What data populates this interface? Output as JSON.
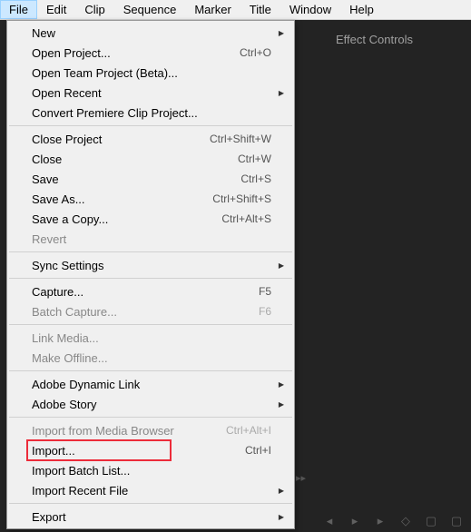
{
  "menubar": {
    "items": [
      "File",
      "Edit",
      "Clip",
      "Sequence",
      "Marker",
      "Title",
      "Window",
      "Help"
    ],
    "active_index": 0
  },
  "panel": {
    "tab_label": "Effect Controls"
  },
  "file_menu": {
    "groups": [
      [
        {
          "label": "New",
          "shortcut": "",
          "submenu": true
        },
        {
          "label": "Open Project...",
          "shortcut": "Ctrl+O"
        },
        {
          "label": "Open Team Project (Beta)...",
          "shortcut": ""
        },
        {
          "label": "Open Recent",
          "shortcut": "",
          "submenu": true
        },
        {
          "label": "Convert Premiere Clip Project...",
          "shortcut": ""
        }
      ],
      [
        {
          "label": "Close Project",
          "shortcut": "Ctrl+Shift+W"
        },
        {
          "label": "Close",
          "shortcut": "Ctrl+W"
        },
        {
          "label": "Save",
          "shortcut": "Ctrl+S"
        },
        {
          "label": "Save As...",
          "shortcut": "Ctrl+Shift+S"
        },
        {
          "label": "Save a Copy...",
          "shortcut": "Ctrl+Alt+S"
        },
        {
          "label": "Revert",
          "shortcut": "",
          "disabled": true
        }
      ],
      [
        {
          "label": "Sync Settings",
          "shortcut": "",
          "submenu": true
        }
      ],
      [
        {
          "label": "Capture...",
          "shortcut": "F5"
        },
        {
          "label": "Batch Capture...",
          "shortcut": "F6",
          "disabled": true
        }
      ],
      [
        {
          "label": "Link Media...",
          "shortcut": "",
          "disabled": true
        },
        {
          "label": "Make Offline...",
          "shortcut": "",
          "disabled": true
        }
      ],
      [
        {
          "label": "Adobe Dynamic Link",
          "shortcut": "",
          "submenu": true
        },
        {
          "label": "Adobe Story",
          "shortcut": "",
          "submenu": true
        }
      ],
      [
        {
          "label": "Import from Media Browser",
          "shortcut": "Ctrl+Alt+I",
          "disabled": true
        },
        {
          "label": "Import...",
          "shortcut": "Ctrl+I",
          "highlighted": true
        },
        {
          "label": "Import Batch List...",
          "shortcut": ""
        },
        {
          "label": "Import Recent File",
          "shortcut": "",
          "submenu": true
        }
      ],
      [
        {
          "label": "Export",
          "shortcut": "",
          "submenu": true
        }
      ]
    ]
  }
}
